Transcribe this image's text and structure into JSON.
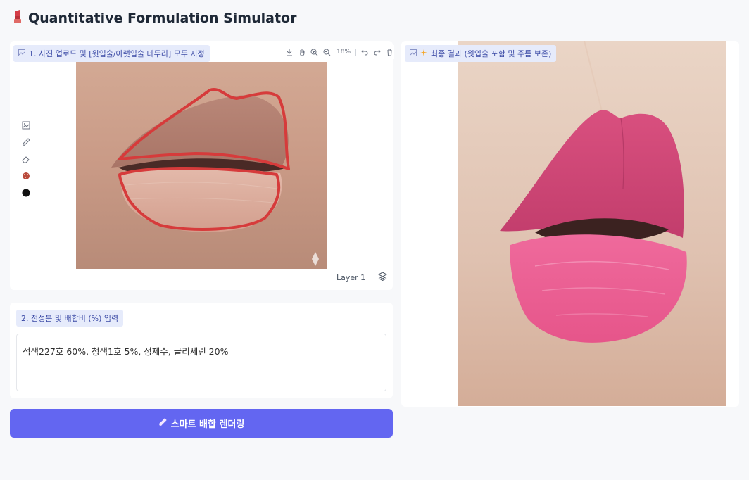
{
  "app": {
    "title": "Quantitative Formulation Simulator",
    "icon": "lipstick-icon"
  },
  "upload_panel": {
    "label": "1. 사진 업로드 및 [윗입술/아랫입술 테두리] 모두 지정",
    "toolbar": {
      "zoom": "18%"
    },
    "tools": [
      "image-icon",
      "brush-icon",
      "eraser-icon",
      "palette-icon",
      "color-swatch-icon"
    ],
    "swatch_color": "#111111",
    "layer_label": "Layer 1",
    "outline_color": "#d63b3b"
  },
  "formula_panel": {
    "label": "2. 전성분 및 배합비 (%) 입력",
    "value": "적색227호 60%, 청색1호 5%, 정제수, 글리세린 20%"
  },
  "render_button": {
    "label": "스마트 배합 렌더링",
    "icon": "brush-icon"
  },
  "result_panel": {
    "label": "최종 결과 (윗입술 포함 및 주름 보존)",
    "lip_color": "#e64f8c"
  }
}
